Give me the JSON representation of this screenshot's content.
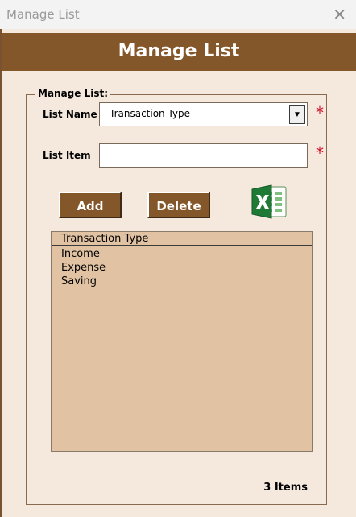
{
  "window": {
    "title": "Manage List",
    "close_icon": "close-icon"
  },
  "header": {
    "title": "Manage List"
  },
  "frame": {
    "label": "Manage List:"
  },
  "fields": {
    "list_name_label": "List Name",
    "list_name_value": "Transaction Type",
    "list_item_label": "List Item",
    "list_item_value": "",
    "required_mark": "*"
  },
  "buttons": {
    "add_label": "Add",
    "delete_label": "Delete",
    "export_icon": "excel-icon"
  },
  "list": {
    "header": "Transaction Type",
    "items": [
      "Income",
      "Expense",
      "Saving"
    ]
  },
  "status": {
    "count": "3 Items"
  },
  "colors": {
    "accent": "#84572a",
    "background": "#f5e8dc",
    "list_background": "#e1c2a2",
    "required": "#d0102a"
  }
}
